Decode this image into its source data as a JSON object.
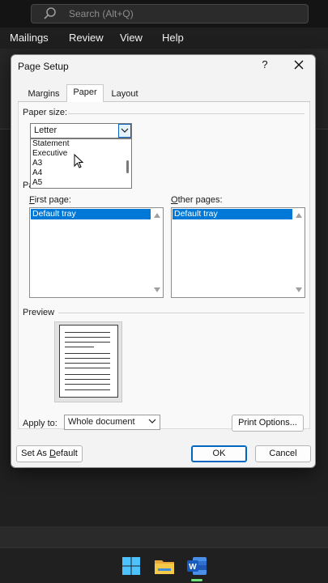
{
  "app": {
    "search_placeholder": "Search (Alt+Q)",
    "ribbon_tabs": [
      "Mailings",
      "Review",
      "View",
      "Help"
    ]
  },
  "dialog": {
    "title": "Page Setup",
    "help": "?",
    "tabs": [
      "Margins",
      "Paper",
      "Layout"
    ],
    "active_tab": "Paper",
    "paper_size": {
      "label": "Paper size:",
      "selected": "Letter",
      "options": [
        "Statement",
        "Executive",
        "A3",
        "A4",
        "A5"
      ]
    },
    "paper_source_fragment": "Pa",
    "first_page": {
      "label": "First page:",
      "selected": "Default tray"
    },
    "other_pages": {
      "label": "Other pages:",
      "selected": "Default tray"
    },
    "preview_label": "Preview",
    "apply_to": {
      "label": "Apply to:",
      "value": "Whole document"
    },
    "print_options_button": "Print Options...",
    "set_default_button": "Set As Default",
    "ok_button": "OK",
    "cancel_button": "Cancel"
  },
  "colors": {
    "selection": "#0078d7",
    "default_button_border": "#0067c0",
    "taskbar_indicator": "#6ee07a"
  }
}
